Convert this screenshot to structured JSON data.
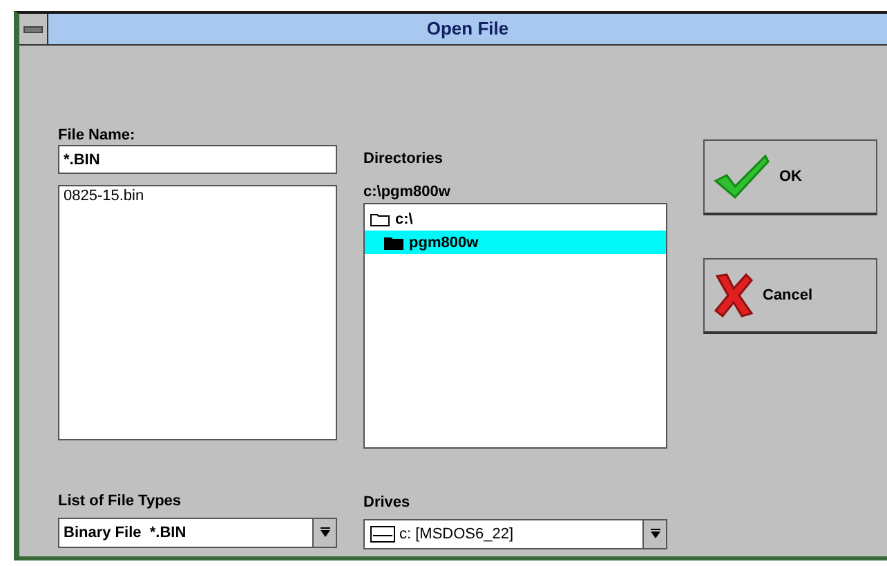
{
  "window": {
    "title": "Open File"
  },
  "file_name": {
    "label": "File Name:",
    "value": "*.BIN"
  },
  "files": [
    {
      "name": "0825-15.bin",
      "selected": false
    }
  ],
  "directories": {
    "label": "Directories",
    "path": "c:\\pgm800w",
    "items": [
      {
        "name": "c:\\",
        "selected": false,
        "children": [
          {
            "name": "pgm800w",
            "selected": true
          }
        ]
      }
    ]
  },
  "file_types": {
    "label": "List of File Types",
    "value": "Binary File  *.BIN"
  },
  "drives": {
    "label": "Drives",
    "value": "c: [MSDOS6_22]"
  },
  "buttons": [
    {
      "kind": "ok",
      "label": "OK"
    },
    {
      "kind": "cancel",
      "label": "Cancel"
    }
  ]
}
